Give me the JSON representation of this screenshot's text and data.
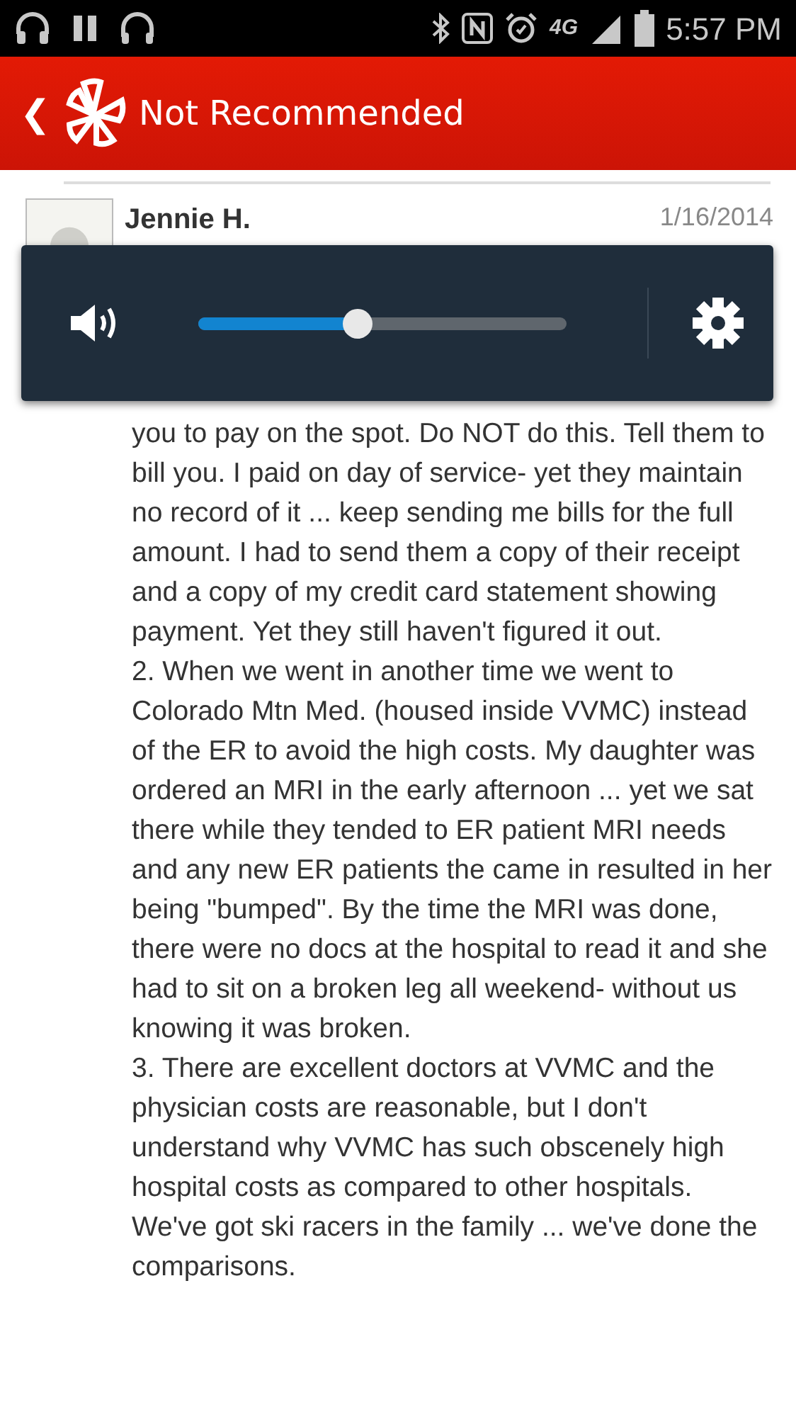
{
  "status_bar": {
    "time": "5:57 PM",
    "network": "4G"
  },
  "header": {
    "back": "❮",
    "title": "Not Recommended"
  },
  "review": {
    "author": "Jennie H.",
    "date": "1/16/2014",
    "paragraphs": [
      "you to pay on the spot. Do NOT do this. Tell them to bill you. I paid on day of service- yet they maintain no record of it ... keep sending me bills for the full amount. I had to send them a copy of their receipt and a copy of my credit card statement showing payment. Yet they still haven't figured it out.",
      "2. When we went in another time we went to Colorado Mtn Med. (housed inside VVMC) instead of the ER to avoid the high costs. My daughter was ordered an MRI in the early afternoon ... yet we sat there while they tended to ER patient MRI needs and any new ER patients the came in resulted in her being \"bumped\". By the time the MRI was done, there were no docs at the hospital to read it and she had to sit on a broken leg all weekend- without us knowing it was broken.",
      "3. There are excellent doctors at VVMC and the physician costs are reasonable, but I don't understand why VVMC has such obscenely high hospital costs as compared to other hospitals. We've got ski racers in the family ... we've done the comparisons."
    ]
  },
  "volume_panel": {
    "level": 0.43
  }
}
